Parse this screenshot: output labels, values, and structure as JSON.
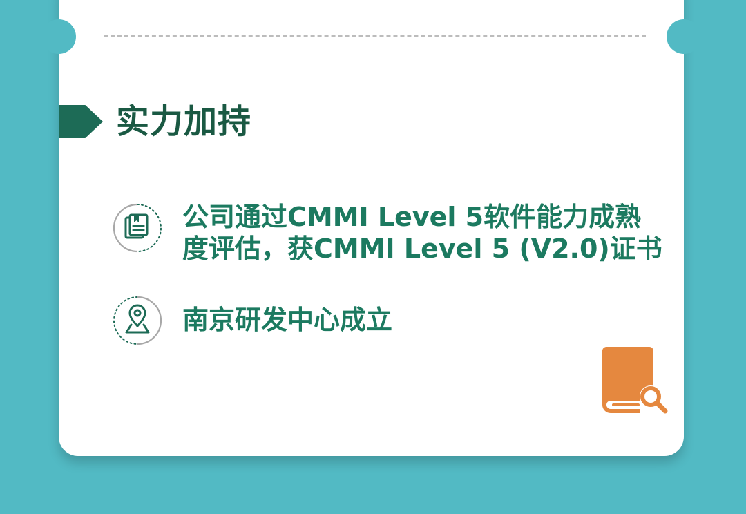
{
  "section": {
    "title": "实力加持"
  },
  "items": [
    {
      "icon": "certificate-icon",
      "lines": [
        "公司通过CMMI Level 5软件能力成熟",
        "度评估，获CMMI Level 5 (V2.0)证书"
      ]
    },
    {
      "icon": "location-pin-icon",
      "lines": [
        "南京研发中心成立"
      ]
    }
  ],
  "decoration": {
    "icon": "book-search-icon"
  },
  "colors": {
    "background": "#52bac4",
    "card": "#ffffff",
    "title": "#1a5943",
    "marker": "#1d6b56",
    "item_text": "#1c7a60",
    "accent_orange": "#e5883f"
  }
}
